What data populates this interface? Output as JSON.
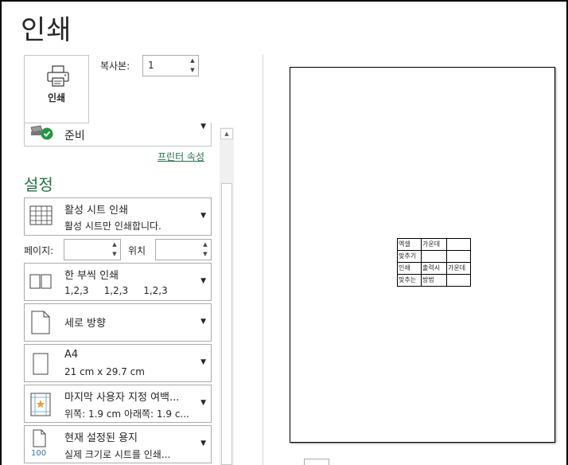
{
  "title": "인쇄",
  "print_button": {
    "label": "인쇄",
    "icon": "printer-icon"
  },
  "copies": {
    "label": "복사본:",
    "value": "1"
  },
  "printer": {
    "status": "준비",
    "icon": "printer-ready-icon",
    "properties_link": "프린터 속성"
  },
  "settings": {
    "heading": "설정",
    "what_to_print": {
      "line1": "활성 시트 인쇄",
      "line2": "활성 시트만 인쇄합니다.",
      "icon": "sheet-grid-icon"
    },
    "pages": {
      "label": "페이지:",
      "to_label": "위치",
      "from_value": "",
      "to_value": ""
    },
    "collation": {
      "line1": "한 부씩 인쇄",
      "line2": "1,2,3     1,2,3     1,2,3",
      "icon": "collated-icon"
    },
    "orientation": {
      "line1": "세로 방향",
      "icon": "portrait-page-icon"
    },
    "paper_size": {
      "line1": "A4",
      "line2": "21 cm x 29.7 cm",
      "icon": "paper-size-icon"
    },
    "margins": {
      "line1": "마지막 사용자 지정 여백...",
      "line2": "위쪽: 1.9 cm 아래쪽: 1.9 c...",
      "icon": "custom-margins-icon"
    },
    "scaling": {
      "line1": "현재 설정된 용지",
      "line2": "실제 크기로 시트를 인쇄...",
      "icon": "actual-size-icon",
      "icon_text": "100"
    }
  },
  "preview": {
    "cells": [
      [
        "엑셀",
        "가운데",
        ""
      ],
      [
        "맞추기",
        "",
        ""
      ],
      [
        "인쇄",
        "출력시",
        "가운데"
      ],
      [
        "맞추는",
        "방법",
        ""
      ]
    ]
  },
  "colors": {
    "accent": "#217346",
    "ready": "#1e9a3c"
  }
}
